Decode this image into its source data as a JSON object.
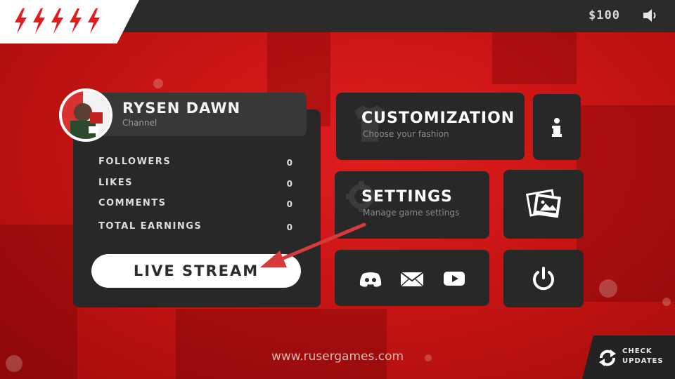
{
  "header": {
    "money": "$100"
  },
  "profile": {
    "name": "RYSEN DAWN",
    "subtitle": "Channel",
    "stats": [
      {
        "label": "FOLLOWERS",
        "value": "0"
      },
      {
        "label": "LIKES",
        "value": "0"
      },
      {
        "label": "COMMENTS",
        "value": "0"
      },
      {
        "label": "TOTAL EARNINGS",
        "value": "0"
      }
    ],
    "live_button": "LIVE STREAM"
  },
  "menu": {
    "customization": {
      "title": "CUSTOMIZATION",
      "subtitle": "Choose your fashion"
    },
    "settings": {
      "title": "SETTINGS",
      "subtitle": "Manage game settings"
    }
  },
  "footer": {
    "website": "www.rusergames.com",
    "update_line1": "CHECK",
    "update_line2": "UPDATES"
  },
  "icons": {
    "logo": "lightning-bolt-icon",
    "sound": "speaker-icon",
    "info": "info-icon",
    "gallery": "photos-icon",
    "discord": "discord-icon",
    "mail": "mail-icon",
    "youtube": "youtube-icon",
    "power": "power-icon",
    "update": "refresh-icon"
  },
  "colors": {
    "accent": "#e41b1b",
    "panel": "#282828",
    "arrow": "#d63a3a"
  }
}
